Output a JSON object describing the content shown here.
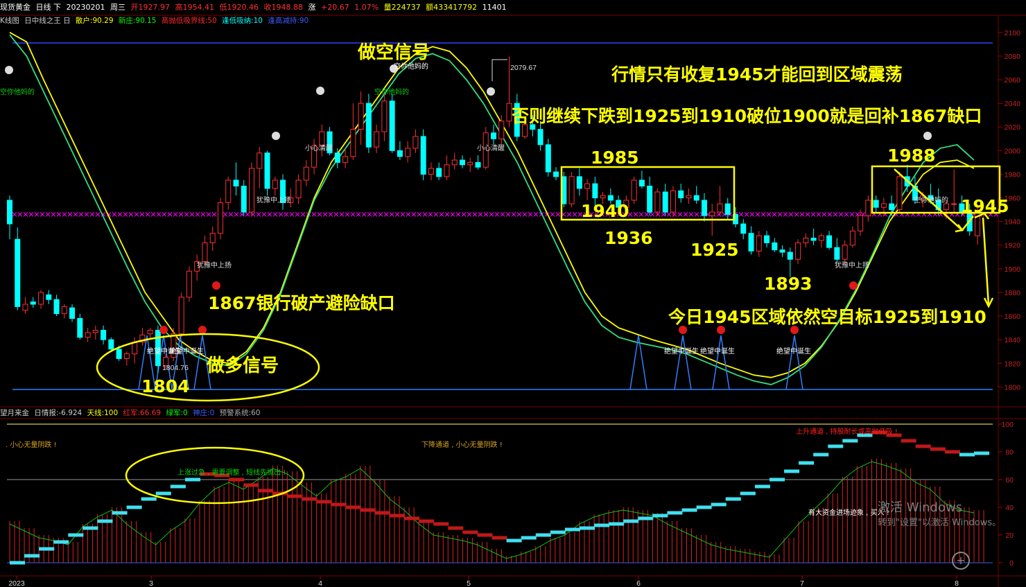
{
  "header": {
    "symbol": "现货黄金",
    "period": "日线 下",
    "date": "20230201",
    "weekday": "周三",
    "open": "开1927.97",
    "high": "高1954.41",
    "low": "低1920.46",
    "close": "收1948.88",
    "change_label": "涨",
    "change": "+20.67",
    "change_pct": "1.07%",
    "volume": "量224737",
    "amount": "额433417792",
    "extra": "11401"
  },
  "indicator_top": {
    "name": "K线图",
    "formula": "日中线之王 日",
    "items": [
      {
        "text": "散户:90.29",
        "color": "#ffff00"
      },
      {
        "text": "新庄:90.15",
        "color": "#00ff00"
      },
      {
        "text": "高抛低吸界线:50",
        "color": "#ff2a2a"
      },
      {
        "text": "逢低吸纳:10",
        "color": "#00ffff"
      },
      {
        "text": "逢高减持:90",
        "color": "#3b5bff"
      }
    ]
  },
  "indicator_bottom": {
    "name": "望月来金",
    "label": "日情报:-6.924",
    "items": [
      {
        "text": "天线:100",
        "color": "#ffff00"
      },
      {
        "text": "红军:66.69",
        "color": "#ff2a2a"
      },
      {
        "text": "绿军:0",
        "color": "#00ff00"
      },
      {
        "text": "神庄:0",
        "color": "#3b5bff"
      },
      {
        "text": "预警系统:60",
        "color": "#aaaaaa"
      }
    ]
  },
  "chart_data": {
    "type": "candlestick",
    "title": "",
    "price_axis": {
      "ticks": [
        "2100",
        "2080",
        "2060",
        "2040",
        "2020",
        "2000",
        "1980",
        "1960",
        "1940",
        "1920",
        "1900",
        "1880",
        "1860",
        "1840",
        "1820",
        "1800"
      ],
      "ylim": [
        1792,
        2104
      ]
    },
    "osc_axis": {
      "ticks": [
        "100",
        "80",
        "60",
        "40",
        "20",
        "0"
      ],
      "ylim": [
        0,
        100
      ]
    },
    "x_axis": {
      "labels": [
        "2023",
        "3",
        "4",
        "5",
        "6",
        "7",
        "8"
      ]
    },
    "candles": [
      {
        "o": 1958,
        "h": 1962,
        "l": 1925,
        "c": 1938
      },
      {
        "o": 1925,
        "h": 1935,
        "l": 1865,
        "c": 1868
      },
      {
        "o": 1865,
        "h": 1876,
        "l": 1862,
        "c": 1870
      },
      {
        "o": 1872,
        "h": 1876,
        "l": 1867,
        "c": 1870
      },
      {
        "o": 1870,
        "h": 1882,
        "l": 1866,
        "c": 1880
      },
      {
        "o": 1878,
        "h": 1882,
        "l": 1870,
        "c": 1874
      },
      {
        "o": 1874,
        "h": 1878,
        "l": 1860,
        "c": 1862
      },
      {
        "o": 1862,
        "h": 1870,
        "l": 1858,
        "c": 1868
      },
      {
        "o": 1867,
        "h": 1870,
        "l": 1855,
        "c": 1858
      },
      {
        "o": 1858,
        "h": 1862,
        "l": 1840,
        "c": 1842
      },
      {
        "o": 1842,
        "h": 1850,
        "l": 1838,
        "c": 1846
      },
      {
        "o": 1846,
        "h": 1852,
        "l": 1840,
        "c": 1848
      },
      {
        "o": 1848,
        "h": 1852,
        "l": 1836,
        "c": 1840
      },
      {
        "o": 1840,
        "h": 1842,
        "l": 1830,
        "c": 1832
      },
      {
        "o": 1832,
        "h": 1835,
        "l": 1822,
        "c": 1824
      },
      {
        "o": 1824,
        "h": 1830,
        "l": 1818,
        "c": 1828
      },
      {
        "o": 1828,
        "h": 1842,
        "l": 1820,
        "c": 1838
      },
      {
        "o": 1838,
        "h": 1850,
        "l": 1835,
        "c": 1844
      },
      {
        "o": 1845,
        "h": 1850,
        "l": 1840,
        "c": 1848
      },
      {
        "o": 1848,
        "h": 1852,
        "l": 1812,
        "c": 1818
      },
      {
        "o": 1818,
        "h": 1828,
        "l": 1815,
        "c": 1825
      },
      {
        "o": 1825,
        "h": 1850,
        "l": 1822,
        "c": 1845
      },
      {
        "o": 1845,
        "h": 1880,
        "l": 1842,
        "c": 1876
      },
      {
        "o": 1876,
        "h": 1902,
        "l": 1872,
        "c": 1898
      },
      {
        "o": 1898,
        "h": 1912,
        "l": 1890,
        "c": 1906
      },
      {
        "o": 1906,
        "h": 1928,
        "l": 1902,
        "c": 1922
      },
      {
        "o": 1922,
        "h": 1936,
        "l": 1915,
        "c": 1930
      },
      {
        "o": 1930,
        "h": 1960,
        "l": 1925,
        "c": 1956
      },
      {
        "o": 1956,
        "h": 1978,
        "l": 1950,
        "c": 1975
      },
      {
        "o": 1975,
        "h": 1990,
        "l": 1962,
        "c": 1970
      },
      {
        "o": 1970,
        "h": 1975,
        "l": 1945,
        "c": 1948
      },
      {
        "o": 1948,
        "h": 1990,
        "l": 1945,
        "c": 1985
      },
      {
        "o": 1985,
        "h": 2003,
        "l": 1968,
        "c": 1998
      },
      {
        "o": 1998,
        "h": 2000,
        "l": 1962,
        "c": 1968
      },
      {
        "o": 1968,
        "h": 1978,
        "l": 1962,
        "c": 1975
      },
      {
        "o": 1975,
        "h": 1980,
        "l": 1950,
        "c": 1956
      },
      {
        "o": 1956,
        "h": 1968,
        "l": 1952,
        "c": 1960
      },
      {
        "o": 1960,
        "h": 1980,
        "l": 1955,
        "c": 1975
      },
      {
        "o": 1975,
        "h": 1992,
        "l": 1970,
        "c": 1986
      },
      {
        "o": 1986,
        "h": 2010,
        "l": 1980,
        "c": 2004
      },
      {
        "o": 2004,
        "h": 2022,
        "l": 1995,
        "c": 2016
      },
      {
        "o": 2016,
        "h": 2020,
        "l": 1996,
        "c": 1998
      },
      {
        "o": 1998,
        "h": 2002,
        "l": 1985,
        "c": 1990
      },
      {
        "o": 1990,
        "h": 2002,
        "l": 1985,
        "c": 1995
      },
      {
        "o": 1995,
        "h": 2040,
        "l": 1992,
        "c": 2018
      },
      {
        "o": 2018,
        "h": 2050,
        "l": 2005,
        "c": 2040
      },
      {
        "o": 2040,
        "h": 2048,
        "l": 1998,
        "c": 2003
      },
      {
        "o": 2003,
        "h": 2022,
        "l": 1998,
        "c": 2016
      },
      {
        "o": 2016,
        "h": 2048,
        "l": 2008,
        "c": 2042
      },
      {
        "o": 2042,
        "h": 2048,
        "l": 1998,
        "c": 2000
      },
      {
        "o": 2000,
        "h": 2008,
        "l": 1992,
        "c": 1995
      },
      {
        "o": 1995,
        "h": 2008,
        "l": 1990,
        "c": 2002
      },
      {
        "o": 2002,
        "h": 2018,
        "l": 1998,
        "c": 2012
      },
      {
        "o": 2012,
        "h": 2018,
        "l": 1975,
        "c": 1980
      },
      {
        "o": 1980,
        "h": 1990,
        "l": 1975,
        "c": 1985
      },
      {
        "o": 1985,
        "h": 1990,
        "l": 1975,
        "c": 1978
      },
      {
        "o": 1978,
        "h": 1996,
        "l": 1975,
        "c": 1988
      },
      {
        "o": 1988,
        "h": 1998,
        "l": 1984,
        "c": 1992
      },
      {
        "o": 1992,
        "h": 1996,
        "l": 1985,
        "c": 1988
      },
      {
        "o": 1988,
        "h": 1994,
        "l": 1982,
        "c": 1990
      },
      {
        "o": 1990,
        "h": 1996,
        "l": 1984,
        "c": 1986
      },
      {
        "o": 1986,
        "h": 2020,
        "l": 1984,
        "c": 2015
      },
      {
        "o": 2015,
        "h": 2022,
        "l": 2005,
        "c": 2010
      },
      {
        "o": 2010,
        "h": 2030,
        "l": 2005,
        "c": 2025
      },
      {
        "o": 2025,
        "h": 2079.67,
        "l": 2020,
        "c": 2040
      },
      {
        "o": 2040,
        "h": 2048,
        "l": 2008,
        "c": 2012
      },
      {
        "o": 2012,
        "h": 2025,
        "l": 2010,
        "c": 2022
      },
      {
        "o": 2022,
        "h": 2030,
        "l": 2012,
        "c": 2018
      },
      {
        "o": 2018,
        "h": 2025,
        "l": 2000,
        "c": 2005
      },
      {
        "o": 2005,
        "h": 2010,
        "l": 1978,
        "c": 1982
      },
      {
        "o": 1982,
        "h": 1986,
        "l": 1975,
        "c": 1978
      },
      {
        "o": 1978,
        "h": 1982,
        "l": 1952,
        "c": 1955
      },
      {
        "o": 1955,
        "h": 1982,
        "l": 1952,
        "c": 1978
      },
      {
        "o": 1978,
        "h": 1985,
        "l": 1962,
        "c": 1968
      },
      {
        "o": 1968,
        "h": 1976,
        "l": 1958,
        "c": 1972
      },
      {
        "o": 1972,
        "h": 1978,
        "l": 1952,
        "c": 1960
      },
      {
        "o": 1960,
        "h": 1965,
        "l": 1955,
        "c": 1962
      },
      {
        "o": 1962,
        "h": 1968,
        "l": 1955,
        "c": 1958
      },
      {
        "o": 1958,
        "h": 1962,
        "l": 1950,
        "c": 1952
      },
      {
        "o": 1952,
        "h": 1962,
        "l": 1948,
        "c": 1958
      },
      {
        "o": 1958,
        "h": 1978,
        "l": 1955,
        "c": 1975
      },
      {
        "o": 1975,
        "h": 1983,
        "l": 1968,
        "c": 1970
      },
      {
        "o": 1970,
        "h": 1978,
        "l": 1945,
        "c": 1948
      },
      {
        "o": 1948,
        "h": 1968,
        "l": 1945,
        "c": 1965
      },
      {
        "o": 1965,
        "h": 1972,
        "l": 1945,
        "c": 1948
      },
      {
        "o": 1948,
        "h": 1970,
        "l": 1944,
        "c": 1966
      },
      {
        "o": 1966,
        "h": 1972,
        "l": 1956,
        "c": 1960
      },
      {
        "o": 1960,
        "h": 1968,
        "l": 1955,
        "c": 1962
      },
      {
        "o": 1962,
        "h": 1970,
        "l": 1955,
        "c": 1958
      },
      {
        "o": 1958,
        "h": 1964,
        "l": 1940,
        "c": 1945
      },
      {
        "o": 1945,
        "h": 1955,
        "l": 1928,
        "c": 1948
      },
      {
        "o": 1948,
        "h": 1970,
        "l": 1945,
        "c": 1955
      },
      {
        "o": 1955,
        "h": 1960,
        "l": 1942,
        "c": 1946
      },
      {
        "o": 1946,
        "h": 1952,
        "l": 1935,
        "c": 1938
      },
      {
        "o": 1938,
        "h": 1942,
        "l": 1925,
        "c": 1930
      },
      {
        "o": 1930,
        "h": 1936,
        "l": 1912,
        "c": 1915
      },
      {
        "o": 1915,
        "h": 1932,
        "l": 1910,
        "c": 1928
      },
      {
        "o": 1928,
        "h": 1932,
        "l": 1918,
        "c": 1922
      },
      {
        "o": 1922,
        "h": 1926,
        "l": 1914,
        "c": 1916
      },
      {
        "o": 1916,
        "h": 1920,
        "l": 1910,
        "c": 1914
      },
      {
        "o": 1914,
        "h": 1918,
        "l": 1893,
        "c": 1908
      },
      {
        "o": 1908,
        "h": 1925,
        "l": 1904,
        "c": 1922
      },
      {
        "o": 1922,
        "h": 1930,
        "l": 1918,
        "c": 1926
      },
      {
        "o": 1926,
        "h": 1934,
        "l": 1920,
        "c": 1924
      },
      {
        "o": 1924,
        "h": 1930,
        "l": 1918,
        "c": 1928
      },
      {
        "o": 1928,
        "h": 1932,
        "l": 1916,
        "c": 1918
      },
      {
        "o": 1918,
        "h": 1926,
        "l": 1905,
        "c": 1908
      },
      {
        "o": 1908,
        "h": 1924,
        "l": 1905,
        "c": 1920
      },
      {
        "o": 1920,
        "h": 1936,
        "l": 1918,
        "c": 1932
      },
      {
        "o": 1932,
        "h": 1950,
        "l": 1928,
        "c": 1945
      },
      {
        "o": 1945,
        "h": 1962,
        "l": 1940,
        "c": 1958
      },
      {
        "o": 1958,
        "h": 1962,
        "l": 1948,
        "c": 1952
      },
      {
        "o": 1952,
        "h": 1960,
        "l": 1945,
        "c": 1955
      },
      {
        "o": 1955,
        "h": 1962,
        "l": 1945,
        "c": 1950
      },
      {
        "o": 1950,
        "h": 1982,
        "l": 1948,
        "c": 1978
      },
      {
        "o": 1978,
        "h": 1988,
        "l": 1965,
        "c": 1970
      },
      {
        "o": 1970,
        "h": 1978,
        "l": 1955,
        "c": 1958
      },
      {
        "o": 1958,
        "h": 1965,
        "l": 1952,
        "c": 1962
      },
      {
        "o": 1962,
        "h": 1972,
        "l": 1955,
        "c": 1958
      },
      {
        "o": 1958,
        "h": 1968,
        "l": 1945,
        "c": 1950
      },
      {
        "o": 1950,
        "h": 1958,
        "l": 1942,
        "c": 1955
      },
      {
        "o": 1955,
        "h": 1984,
        "l": 1948,
        "c": 1955
      },
      {
        "o": 1955,
        "h": 1962,
        "l": 1945,
        "c": 1948
      },
      {
        "o": 1948,
        "h": 1955,
        "l": 1928,
        "c": 1932
      },
      {
        "o": 1927.97,
        "h": 1954.41,
        "l": 1920.46,
        "c": 1948.88
      }
    ],
    "series": [
      {
        "name": "散户",
        "color": "#ffff00",
        "values": [
          2100,
          2092,
          2060,
          2030,
          2000,
          1970,
          1940,
          1910,
          1880,
          1860,
          1840,
          1830,
          1822,
          1820,
          1830,
          1850,
          1880,
          1920,
          1960,
          1990,
          2010,
          2030,
          2050,
          2070,
          2082,
          2088,
          2084,
          2070,
          2050,
          2025,
          2000,
          1970,
          1940,
          1910,
          1880,
          1860,
          1850,
          1845,
          1840,
          1836,
          1832,
          1826,
          1820,
          1815,
          1810,
          1808,
          1812,
          1820,
          1835,
          1855,
          1880,
          1910,
          1940,
          1960,
          1980,
          1990,
          1992,
          1985
        ]
      },
      {
        "name": "新庄",
        "color": "#30e080",
        "values": [
          2098,
          2080,
          2050,
          2020,
          1990,
          1960,
          1930,
          1900,
          1872,
          1850,
          1835,
          1826,
          1820,
          1818,
          1828,
          1848,
          1878,
          1918,
          1958,
          1985,
          2005,
          2025,
          2045,
          2065,
          2078,
          2082,
          2076,
          2060,
          2040,
          2015,
          1990,
          1960,
          1930,
          1900,
          1872,
          1852,
          1842,
          1838,
          1835,
          1832,
          1828,
          1822,
          1816,
          1810,
          1805,
          1802,
          1808,
          1818,
          1834,
          1856,
          1882,
          1912,
          1944,
          1968,
          1990,
          2002,
          2005,
          1992
        ]
      }
    ],
    "osc_series": [
      {
        "name": "天线",
        "color": "#ffff00",
        "values": [
          100
        ]
      },
      {
        "name": "红军",
        "values": [
          0,
          5,
          10,
          15,
          20,
          25,
          30,
          36,
          40,
          46,
          50,
          55,
          60,
          64,
          63,
          60,
          56,
          52,
          50,
          48,
          46,
          44,
          42,
          40,
          38,
          36,
          34,
          32,
          30,
          28,
          25,
          22,
          20,
          18,
          16,
          18,
          20,
          22,
          24,
          25,
          27,
          28,
          30,
          32,
          34,
          36,
          38,
          40,
          42,
          46,
          50,
          55,
          60,
          66,
          72,
          78,
          84,
          88,
          92,
          94,
          92,
          88,
          84,
          82,
          80,
          78,
          79
        ]
      },
      {
        "name": "绿军",
        "values": [
          0,
          0,
          0,
          0,
          0,
          0,
          0,
          0,
          0,
          0,
          0,
          0,
          0,
          0,
          0,
          0,
          0,
          0,
          0,
          0,
          0,
          0,
          0,
          0,
          0,
          0,
          0,
          0,
          0,
          0,
          0,
          0,
          0,
          0,
          0,
          0,
          0,
          0,
          0,
          0,
          0,
          0,
          0,
          0,
          0,
          0,
          0,
          0,
          0,
          0,
          0,
          0,
          0,
          0,
          0,
          0,
          0,
          0,
          0,
          0,
          0,
          0,
          0,
          0,
          0,
          0,
          0
        ]
      }
    ],
    "annotations": {
      "short_signal": "做空信号",
      "long_signal": "做多信号",
      "main_note": "行情只有收复1945才能回到区域震荡",
      "sub_note": "否则继续下跌到1925到1910破位1900就是回补1867缺口",
      "gap_note": "1867银行破产避险缺口",
      "today_note": "今日1945区域依然空目标1925到1910",
      "levels": [
        "1804",
        "1985",
        "1940",
        "1936",
        "1925",
        "1893",
        "1988",
        "1945"
      ],
      "high_price": "2079.67",
      "low_price": "1804.76",
      "small_labels": [
        "空你他妈的",
        "空你他妈的",
        "小心清醒",
        "小心清醒",
        "犹豫中上扬",
        "犹豫中上扬",
        "犹豫中上扬",
        "空你他妈的",
        "空你他妈的",
        "绝望中诞生",
        "绝望中诞生",
        "绝望中诞生",
        "绝望中诞生",
        "绝望中诞生"
      ],
      "osc_notes": [
        ". 小心无量阴跌 !",
        "下降通道 , 小心无量阴跌 !",
        "上升通道 , 持股耐长或高抛低吸 !",
        "上涨过急 , 需要调整 , 短线先抛出 !",
        "有大资金进场迹象 , 买入 !"
      ]
    }
  },
  "watermark": {
    "line1": "激活 Windows",
    "line2": "转到\"设置\"以激活 Windows。"
  },
  "zoom_icon": "zoom-in-icon",
  "colors": {
    "up": "#ff3030",
    "down": "#00ffff",
    "accent": "#ffff00",
    "magenta": "#ff00ff",
    "blue": "#3b5bff"
  }
}
